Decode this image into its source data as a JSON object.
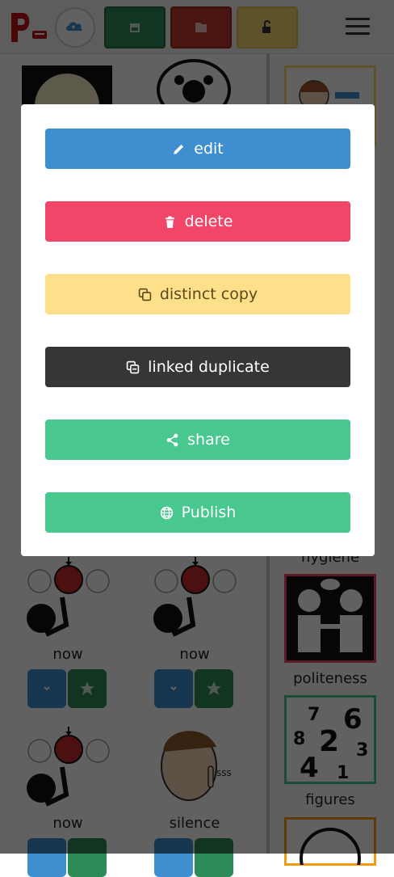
{
  "modal": {
    "edit_label": "edit",
    "delete_label": "delete",
    "copy_label": "distinct copy",
    "linked_label": "linked duplicate",
    "share_label": "share",
    "publish_label": "Publish"
  },
  "grid": {
    "left_labels": [
      "now",
      "now",
      "now",
      "silence"
    ],
    "right_labels": [
      "hygiene",
      "politeness",
      "figures"
    ]
  },
  "figures_picto": {
    "digits": [
      "7",
      "6",
      "8",
      "2",
      "3",
      "4",
      "1"
    ]
  },
  "colors": {
    "edit": "#3e8ed0",
    "delete": "#f14668",
    "copy": "#ffe08a",
    "linked": "#363636",
    "share": "#48c78e",
    "publish": "#48c78e",
    "toolbar_green": "#2e8b57",
    "toolbar_red": "#c0392b",
    "toolbar_yellow": "#f5d76e"
  },
  "icons": [
    "logo-icon",
    "cloud-icon",
    "image-icon",
    "folder-icon",
    "unlock-icon",
    "menu-icon",
    "pencil-icon",
    "trash-icon",
    "copy-icon",
    "linked-icon",
    "share-icon",
    "globe-icon",
    "star-icon",
    "chevron-icon"
  ]
}
